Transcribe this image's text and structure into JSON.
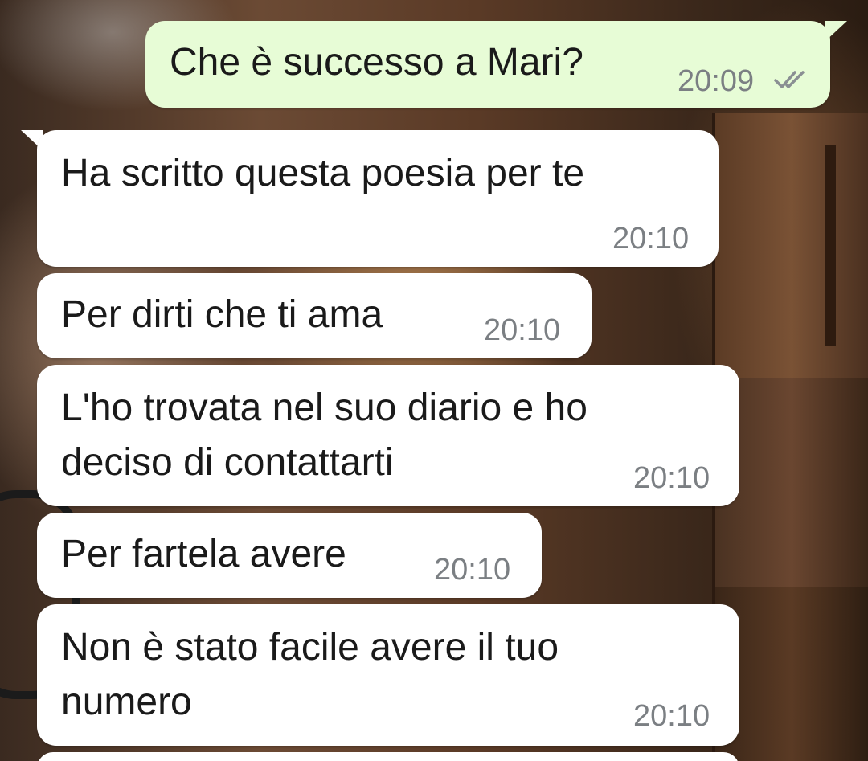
{
  "colors": {
    "incoming_bubble": "#ffffff",
    "outgoing_bubble": "#e7fcd6",
    "timestamp": "#7b7f83",
    "text": "#1a1a1a"
  },
  "messages": [
    {
      "direction": "outgoing",
      "text": "Che è successo a Mari?",
      "time": "20:09",
      "status_icon": "double-check-icon"
    },
    {
      "direction": "incoming",
      "text": "Ha scritto questa poesia per te",
      "time": "20:10"
    },
    {
      "direction": "incoming",
      "text": "Per dirti che ti ama",
      "time": "20:10"
    },
    {
      "direction": "incoming",
      "text": "L'ho trovata nel suo diario e ho\ndeciso di contattarti",
      "time": "20:10"
    },
    {
      "direction": "incoming",
      "text": "Per fartela avere",
      "time": "20:10"
    },
    {
      "direction": "incoming",
      "text": "Non è stato facile avere il tuo\nnumero",
      "time": "20:10"
    }
  ]
}
